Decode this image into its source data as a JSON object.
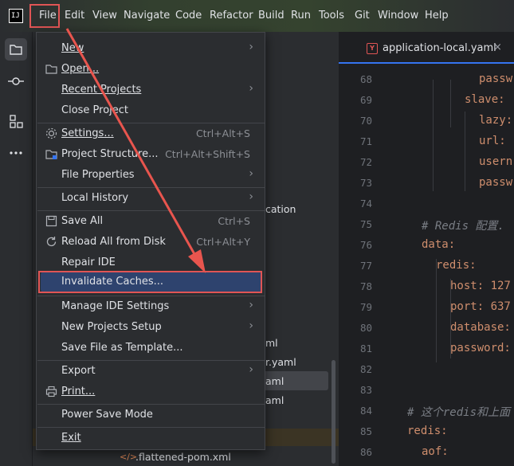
{
  "menubar": {
    "logo_text": "IJ",
    "items": [
      "File",
      "Edit",
      "View",
      "Navigate",
      "Code",
      "Refactor",
      "Build",
      "Run",
      "Tools",
      "Git",
      "Window",
      "Help"
    ]
  },
  "editor": {
    "tab_label": "application-local.yaml",
    "tab_icon_letter": "Y",
    "tab_close": "×",
    "lines": [
      {
        "num": "68",
        "text": "passw"
      },
      {
        "num": "69",
        "text": "slave:"
      },
      {
        "num": "70",
        "text": "lazy:"
      },
      {
        "num": "71",
        "text": "url:"
      },
      {
        "num": "72",
        "text": "usern"
      },
      {
        "num": "73",
        "text": "passw"
      },
      {
        "num": "74",
        "text": ""
      },
      {
        "num": "75",
        "text": "# Redis 配置."
      },
      {
        "num": "76",
        "text": "data:"
      },
      {
        "num": "77",
        "text": "redis:"
      },
      {
        "num": "78",
        "text": "host: 127"
      },
      {
        "num": "79",
        "text": "port: 637"
      },
      {
        "num": "80",
        "text": "database:"
      },
      {
        "num": "81",
        "text": "password:"
      },
      {
        "num": "82",
        "text": ""
      },
      {
        "num": "83",
        "text": ""
      },
      {
        "num": "84",
        "text": "# 这个redis和上面"
      },
      {
        "num": "85",
        "text": "redis:"
      },
      {
        "num": "86",
        "text": "aof:"
      }
    ]
  },
  "project_tree": {
    "fragments": [
      "cation",
      "ml",
      "r.yaml",
      "aml",
      "aml"
    ],
    "bottom_file": ".flattened-pom.xml",
    "bottom_file_icon": "</>"
  },
  "file_menu": {
    "items": [
      {
        "label": "New",
        "shortcut": "",
        "submenu": true
      },
      {
        "label": "Open...",
        "shortcut": "",
        "submenu": false
      },
      {
        "label": "Recent Projects",
        "shortcut": "",
        "submenu": true
      },
      {
        "label": "Close Project",
        "shortcut": "",
        "submenu": false
      },
      {
        "label": "Settings...",
        "shortcut": "Ctrl+Alt+S",
        "submenu": false
      },
      {
        "label": "Project Structure...",
        "shortcut": "Ctrl+Alt+Shift+S",
        "submenu": false
      },
      {
        "label": "File Properties",
        "shortcut": "",
        "submenu": true
      },
      {
        "label": "Local History",
        "shortcut": "",
        "submenu": true
      },
      {
        "label": "Save All",
        "shortcut": "Ctrl+S",
        "submenu": false
      },
      {
        "label": "Reload All from Disk",
        "shortcut": "Ctrl+Alt+Y",
        "submenu": false
      },
      {
        "label": "Repair IDE",
        "shortcut": "",
        "submenu": false
      },
      {
        "label": "Invalidate Caches...",
        "shortcut": "",
        "submenu": false
      },
      {
        "label": "Manage IDE Settings",
        "shortcut": "",
        "submenu": true
      },
      {
        "label": "New Projects Setup",
        "shortcut": "",
        "submenu": true
      },
      {
        "label": "Save File as Template...",
        "shortcut": "",
        "submenu": false
      },
      {
        "label": "Export",
        "shortcut": "",
        "submenu": true
      },
      {
        "label": "Print...",
        "shortcut": "",
        "submenu": false
      },
      {
        "label": "Power Save Mode",
        "shortcut": "",
        "submenu": false
      },
      {
        "label": "Exit",
        "shortcut": "",
        "submenu": false
      }
    ],
    "submenu_arrow": "›"
  },
  "colors": {
    "annotation_red": "#e05555",
    "selection_blue": "#2e436e",
    "yaml_key": "#cf8e6d",
    "comment": "#7a7e85"
  }
}
